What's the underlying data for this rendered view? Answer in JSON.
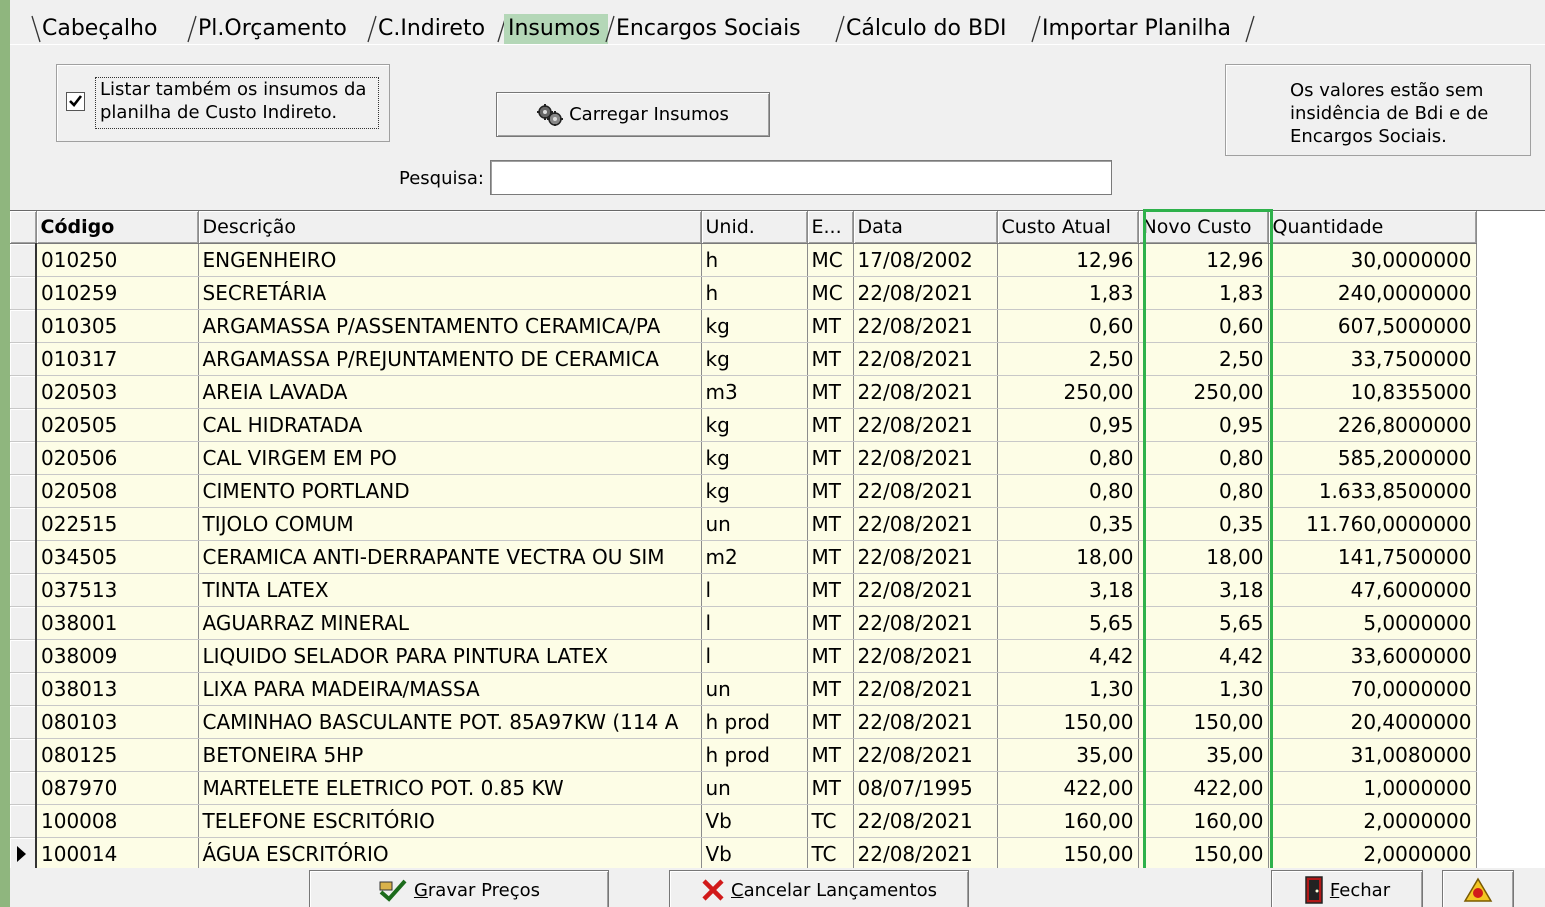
{
  "tabs": [
    "Cabeçalho",
    "Pl.Orçamento",
    "C.Indireto",
    "Insumos",
    "Encargos Sociais",
    "Cálculo do BDI",
    "Importar Planilha"
  ],
  "active_tab": "Insumos",
  "checkbox": {
    "checked": true,
    "label_line1": "Listar também os insumos da",
    "label_line2": "planilha de Custo Indireto."
  },
  "load_button": "Carregar Insumos",
  "note": {
    "line1": "Os valores estão sem",
    "line2": "insidência de Bdi e de",
    "line3": "Encargos Sociais."
  },
  "search": {
    "label": "Pesquisa:",
    "value": ""
  },
  "grid": {
    "columns": [
      "Código",
      "Descrição",
      "Unid.",
      "E...",
      "Data",
      "Custo Atual",
      "Novo Custo",
      "Quantidade"
    ],
    "rows": [
      [
        "010250",
        "ENGENHEIRO",
        "h",
        "MC",
        "17/08/2002",
        "12,96",
        "12,96",
        "30,0000000"
      ],
      [
        "010259",
        "SECRETÁRIA",
        "h",
        "MC",
        "22/08/2021",
        "1,83",
        "1,83",
        "240,0000000"
      ],
      [
        "010305",
        "ARGAMASSA P/ASSENTAMENTO CERAMICA/PA",
        "kg",
        "MT",
        "22/08/2021",
        "0,60",
        "0,60",
        "607,5000000"
      ],
      [
        "010317",
        "ARGAMASSA P/REJUNTAMENTO DE CERAMICA",
        "kg",
        "MT",
        "22/08/2021",
        "2,50",
        "2,50",
        "33,7500000"
      ],
      [
        "020503",
        "AREIA LAVADA",
        "m3",
        "MT",
        "22/08/2021",
        "250,00",
        "250,00",
        "10,8355000"
      ],
      [
        "020505",
        "CAL HIDRATADA",
        "kg",
        "MT",
        "22/08/2021",
        "0,95",
        "0,95",
        "226,8000000"
      ],
      [
        "020506",
        "CAL VIRGEM EM PO",
        "kg",
        "MT",
        "22/08/2021",
        "0,80",
        "0,80",
        "585,2000000"
      ],
      [
        "020508",
        "CIMENTO PORTLAND",
        "kg",
        "MT",
        "22/08/2021",
        "0,80",
        "0,80",
        "1.633,8500000"
      ],
      [
        "022515",
        "TIJOLO COMUM",
        "un",
        "MT",
        "22/08/2021",
        "0,35",
        "0,35",
        "11.760,0000000"
      ],
      [
        "034505",
        "CERAMICA ANTI-DERRAPANTE VECTRA OU SIM",
        "m2",
        "MT",
        "22/08/2021",
        "18,00",
        "18,00",
        "141,7500000"
      ],
      [
        "037513",
        "TINTA LATEX",
        "l",
        "MT",
        "22/08/2021",
        "3,18",
        "3,18",
        "47,6000000"
      ],
      [
        "038001",
        "AGUARRAZ MINERAL",
        "l",
        "MT",
        "22/08/2021",
        "5,65",
        "5,65",
        "5,0000000"
      ],
      [
        "038009",
        "LIQUIDO SELADOR PARA PINTURA LATEX",
        "l",
        "MT",
        "22/08/2021",
        "4,42",
        "4,42",
        "33,6000000"
      ],
      [
        "038013",
        "LIXA PARA MADEIRA/MASSA",
        "un",
        "MT",
        "22/08/2021",
        "1,30",
        "1,30",
        "70,0000000"
      ],
      [
        "080103",
        "CAMINHAO BASCULANTE POT. 85A97KW (114 A",
        "h prod",
        "MT",
        "22/08/2021",
        "150,00",
        "150,00",
        "20,4000000"
      ],
      [
        "080125",
        "BETONEIRA 5HP",
        "h prod",
        "MT",
        "22/08/2021",
        "35,00",
        "35,00",
        "31,0080000"
      ],
      [
        "087970",
        "MARTELETE ELETRICO POT. 0.85 KW",
        "un",
        "MT",
        "08/07/1995",
        "422,00",
        "422,00",
        "1,0000000"
      ],
      [
        "100008",
        "TELEFONE ESCRITÓRIO",
        "Vb",
        "TC",
        "22/08/2021",
        "160,00",
        "160,00",
        "2,0000000"
      ],
      [
        "100014",
        "ÁGUA ESCRITÓRIO",
        "Vb",
        "TC",
        "22/08/2021",
        "150,00",
        "150,00",
        "2,0000000"
      ]
    ],
    "current_row": 18
  },
  "buttons": {
    "save": {
      "accel": "G",
      "rest": "ravar Preços"
    },
    "cancel": {
      "accel": "C",
      "rest": "ancelar Lançamentos"
    },
    "close": {
      "accel": "F",
      "rest": "echar"
    }
  },
  "colors": {
    "highlight": "#2eb14b",
    "active_tab": "#b4d7b7",
    "grid_row": "#fdfde6",
    "background": "#8fb67e"
  }
}
